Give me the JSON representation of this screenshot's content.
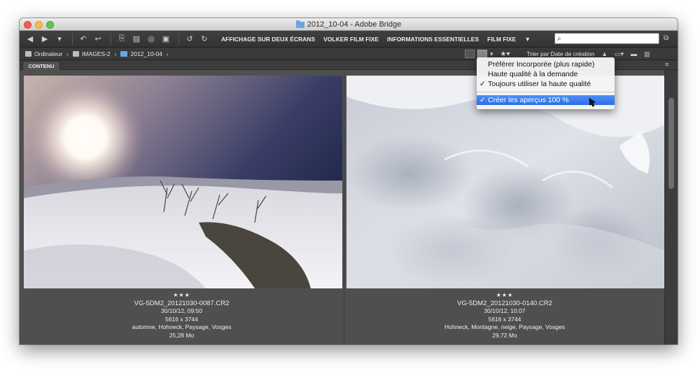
{
  "window": {
    "title": "2012_10-04 - Adobe Bridge"
  },
  "toolbar": {
    "workspaces": [
      "AFFICHAGE SUR DEUX ÉCRANS",
      "VOLKER FILM FIXE",
      "INFORMATIONS ESSENTIELLES",
      "FILM FIXE"
    ],
    "search_placeholder": ""
  },
  "path": {
    "items": [
      "Ordinateur",
      "IMAGES-2",
      "2012_10-04"
    ]
  },
  "sort": {
    "label": "Trier par Date de création"
  },
  "panel": {
    "tab_label": "CONTENU"
  },
  "dropdown": {
    "items": [
      {
        "label": "Préférer Incorporée (plus rapide)",
        "checked": false
      },
      {
        "label": "Haute qualité à la demande",
        "checked": false
      },
      {
        "label": "Toujours utiliser la haute qualité",
        "checked": true
      },
      {
        "label": "Créer les aperçus 100 %",
        "checked": true,
        "highlighted": true
      }
    ]
  },
  "thumbnails": [
    {
      "stars": "★★★",
      "filename": "VG-5DM2_20121030-0087.CR2",
      "datetime": "30/10/12, 09:50",
      "dimensions": "5616 x 3744",
      "keywords": "automne, Hohneck, Paysage, Vosges",
      "size": "25,28 Mo"
    },
    {
      "stars": "★★★",
      "filename": "VG-5DM2_20121030-0140.CR2",
      "datetime": "30/10/12, 10:07",
      "dimensions": "5616 x 3744",
      "keywords": "Hohneck, Montagne, neige, Paysage, Vosges",
      "size": "29,72 Mo"
    }
  ],
  "colors": {
    "accent": "#2a6fe6",
    "panel": "#4f4f4f"
  }
}
